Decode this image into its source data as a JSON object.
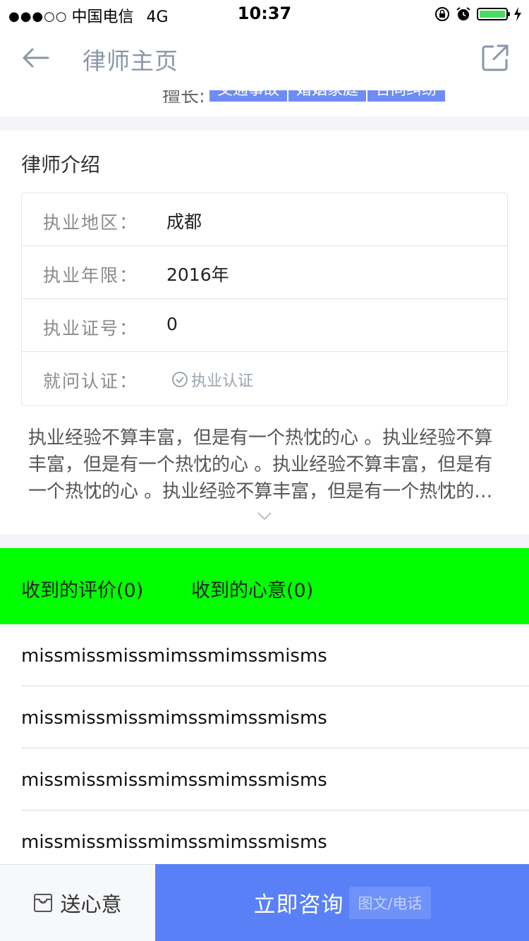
{
  "status_bar": {
    "signal_dots": "●●●○○",
    "carrier": "中国电信",
    "network": "4G",
    "time": "10:37",
    "battery_level": 1.0,
    "battery_color": "#4cd964"
  },
  "nav": {
    "title": "律师主页"
  },
  "specialty": {
    "label": "擅长:",
    "tags": [
      "交通事故",
      "婚姻家庭",
      "合同纠纷"
    ],
    "tag_color": "#6f8cf3"
  },
  "intro": {
    "title": "律师介绍",
    "rows": [
      {
        "label": "执业地区：",
        "value": "成都"
      },
      {
        "label": "执业年限：",
        "value": "2016年"
      },
      {
        "label": "执业证号：",
        "value": "0"
      },
      {
        "label": "就问认证：",
        "badge": "执业认证"
      }
    ],
    "text": "执业经验不算丰富，但是有一个热忱的心 。执业经验不算丰富，但是有一个热忱的心 。执业经验不算丰富，但是有一个热忱的心 。执业经验不算丰富，但是有一个热忱的心 。"
  },
  "tabs": {
    "background": "#00ff00",
    "items": [
      {
        "label": "收到的评价(0)"
      },
      {
        "label": "收到的心意(0)"
      }
    ]
  },
  "reviews": [
    "missmissmissmimssmimssmisms",
    "missmissmissmimssmimssmisms",
    "missmissmissmimssmimssmisms",
    "missmissmissmimssmimssmisms"
  ],
  "bottom_bar": {
    "gift_label": "送心意",
    "consult_label": "立即咨询",
    "consult_sub": "图文/电话",
    "consult_color": "#5a80f7"
  }
}
